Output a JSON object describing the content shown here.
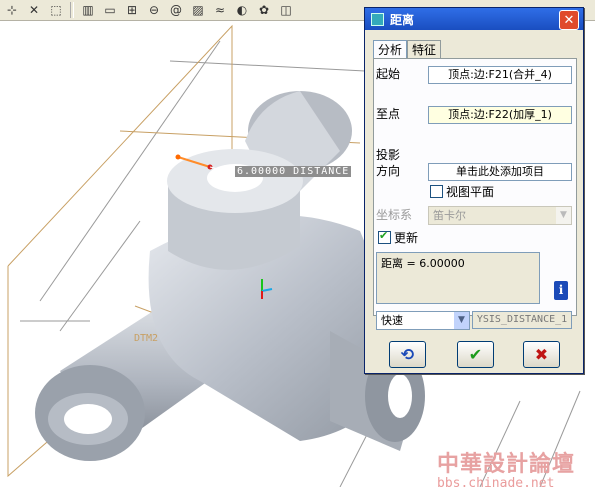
{
  "dialog": {
    "title": "距离",
    "tabs": [
      "分析",
      "特征"
    ],
    "from_label": "起始",
    "from_value": "顶点:边:F21(合并_4)",
    "to_label": "至点",
    "to_value": "顶点:边:F22(加厚_1)",
    "projection_label_1": "投影",
    "projection_label_2": "方向",
    "projection_value": "单击此处添加项目",
    "view_plane_label": "视图平面",
    "coord_sys_label": "坐标系",
    "coord_sys_value": "笛卡尔",
    "update_label": "更新",
    "result_text": "距离 = 6.00000",
    "mode_value": "快速",
    "name_value": "YSIS_DISTANCE_1"
  },
  "viewport": {
    "dimension_text": "6.00000  DISTANCE",
    "datum_label": "DTM2"
  },
  "watermark": {
    "cn": "中華設計論壇",
    "url": "bbs.chinade.net"
  },
  "colors": {
    "part": "#c9cdd4",
    "datum": "#c8a064",
    "title_blue": "#1f55d3"
  }
}
